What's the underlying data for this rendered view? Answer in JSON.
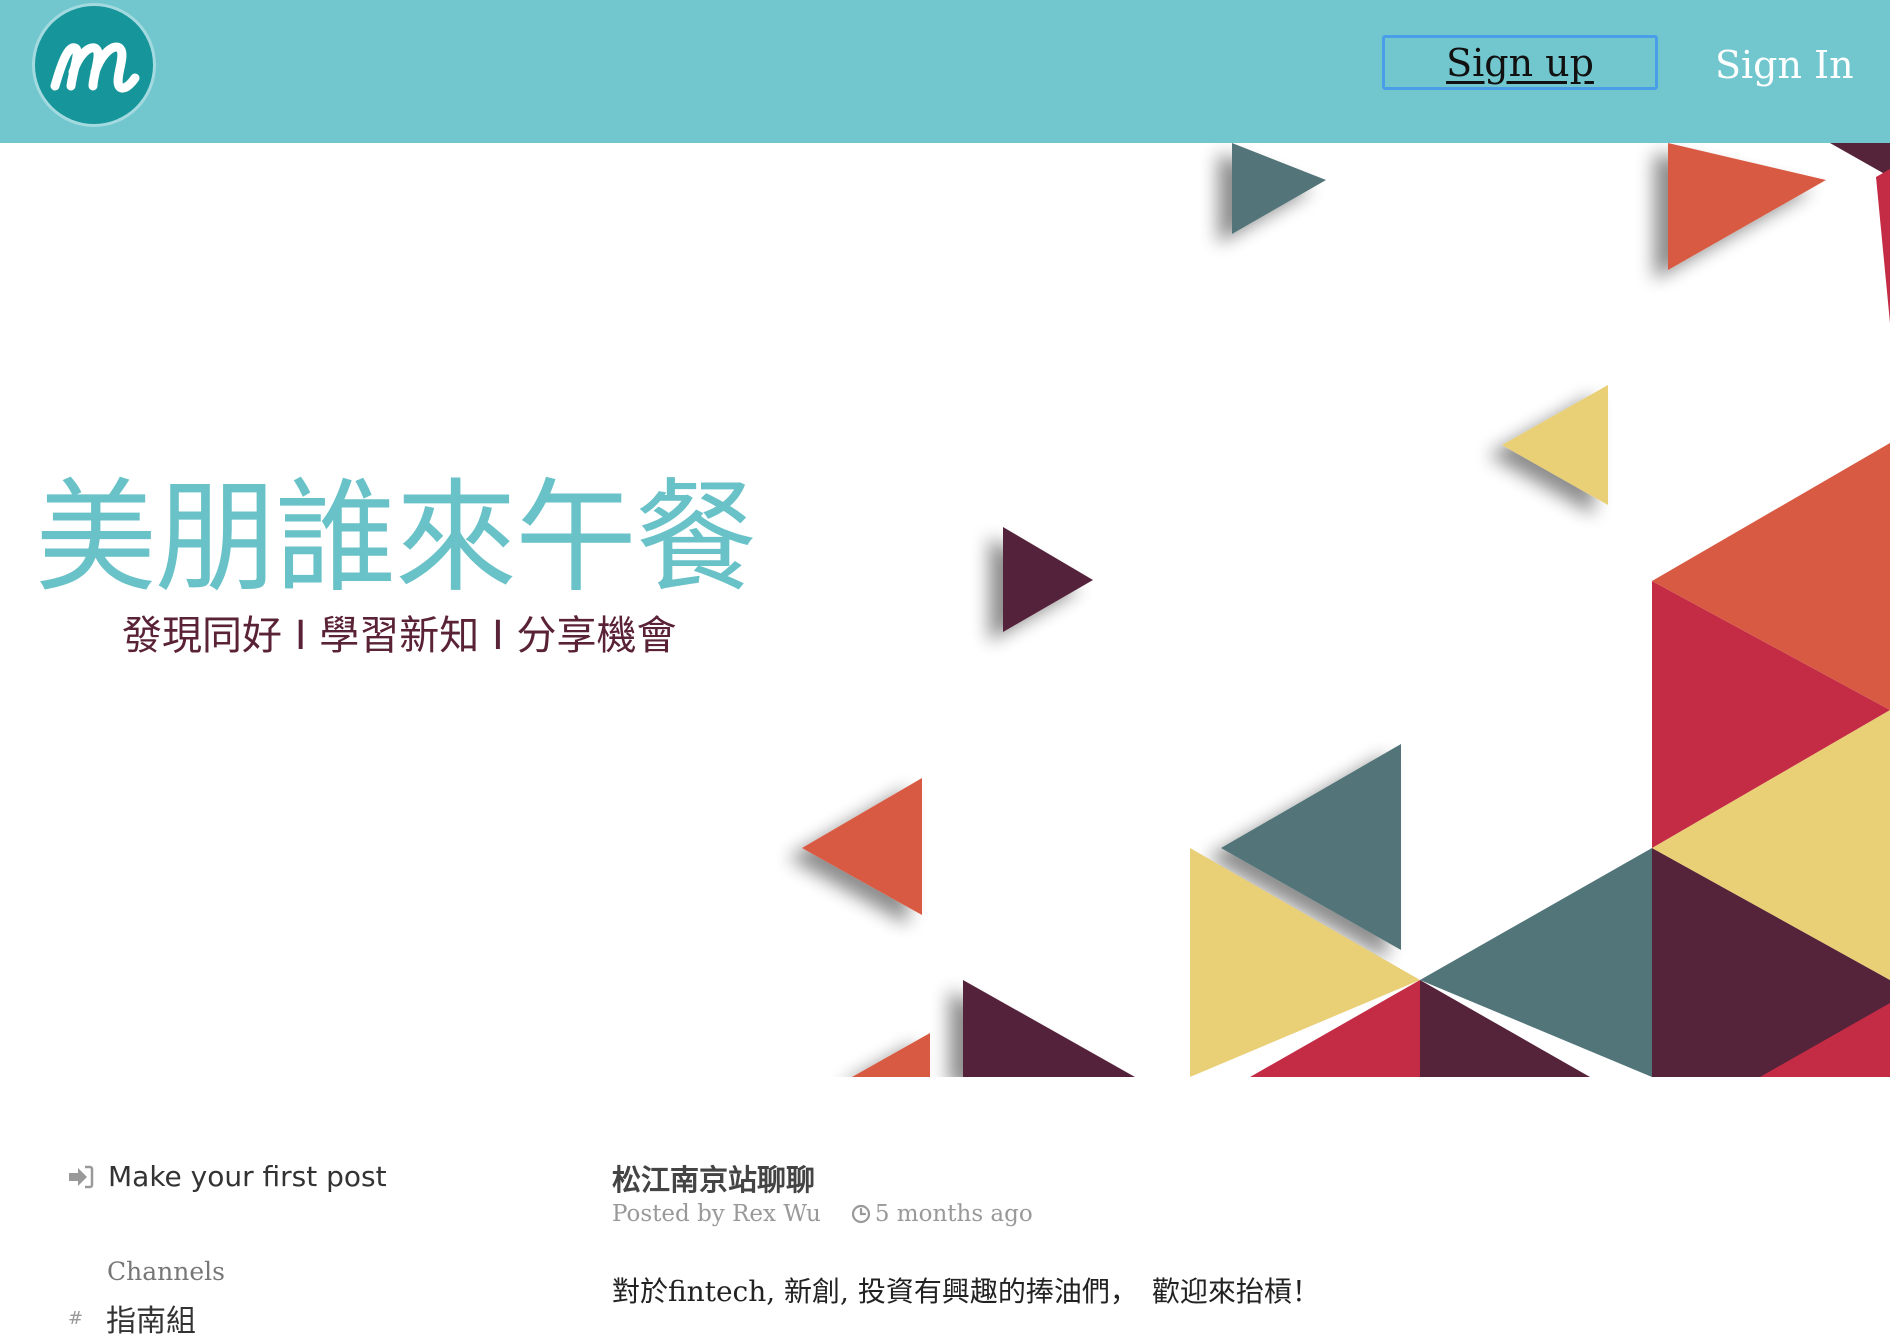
{
  "header": {
    "logo_letter": "m",
    "signup_label": "Sign up",
    "signin_label": "Sign In"
  },
  "hero": {
    "title": "美朋誰來午餐",
    "subtitle": "發現同好 I 學習新知 I 分享機會"
  },
  "sidebar": {
    "make_post_label": "Make your first post",
    "channels_heading": "Channels",
    "channels": [
      {
        "label": "指南組"
      }
    ]
  },
  "post": {
    "title": "松江南京站聊聊",
    "author_line": "Posted by Rex Wu",
    "time": "5 months ago",
    "body": "對於fintech, 新創, 投資有興趣的捧油們，　歡迎來抬槓！"
  },
  "colors": {
    "header_bg": "#72c7cf",
    "logo_bg": "#16959a",
    "hero_title": "#69c2c8",
    "hero_subtitle": "#5a2236",
    "tri_teal": "#527579",
    "tri_orange": "#d95a43",
    "tri_yellow": "#e9cf76",
    "tri_plum": "#55233a",
    "tri_red": "#c42c45"
  },
  "icons": {
    "logo": "m-logo-icon",
    "make_post": "sign-in-arrow-icon",
    "time": "clock-icon",
    "channel": "hash-icon"
  }
}
